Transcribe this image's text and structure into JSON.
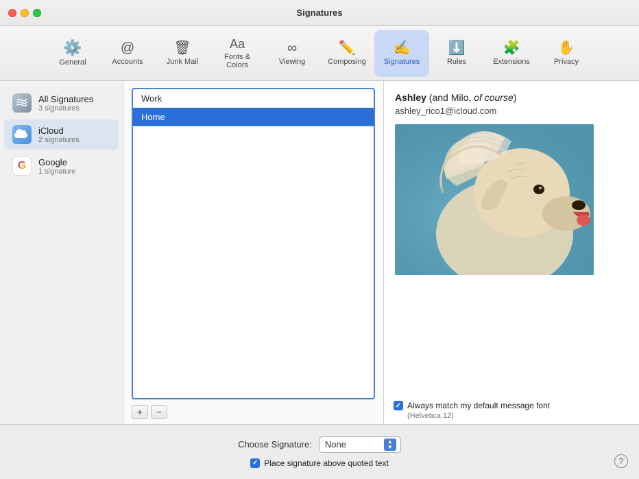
{
  "window": {
    "title": "Signatures"
  },
  "toolbar": {
    "items": [
      {
        "id": "general",
        "label": "General",
        "icon": "⚙️"
      },
      {
        "id": "accounts",
        "label": "Accounts",
        "icon": "＠"
      },
      {
        "id": "junk-mail",
        "label": "Junk Mail",
        "icon": "🗑"
      },
      {
        "id": "fonts-colors",
        "label": "Fonts & Colors",
        "icon": "Aa"
      },
      {
        "id": "viewing",
        "label": "Viewing",
        "icon": "∞"
      },
      {
        "id": "composing",
        "label": "Composing",
        "icon": "✏"
      },
      {
        "id": "signatures",
        "label": "Signatures",
        "icon": "✍"
      },
      {
        "id": "rules",
        "label": "Rules",
        "icon": "↓"
      },
      {
        "id": "extensions",
        "label": "Extensions",
        "icon": "🧩"
      },
      {
        "id": "privacy",
        "label": "Privacy",
        "icon": "✋"
      }
    ]
  },
  "sidebar": {
    "items": [
      {
        "id": "all-signatures",
        "name": "All Signatures",
        "count": "3 signatures",
        "iconType": "all"
      },
      {
        "id": "icloud",
        "name": "iCloud",
        "count": "2 signatures",
        "iconType": "icloud"
      },
      {
        "id": "google",
        "name": "Google",
        "count": "1 signature",
        "iconType": "google"
      }
    ]
  },
  "signatures_list": {
    "items": [
      {
        "id": "work",
        "label": "Work",
        "selected": false
      },
      {
        "id": "home",
        "label": "Home",
        "selected": true
      }
    ],
    "add_button": "+",
    "remove_button": "−"
  },
  "preview": {
    "name_bold": "Ashley",
    "name_rest": " (and Milo, ",
    "name_italic": "of course",
    "name_end": ")",
    "email": "ashley_rico1@icloud.com"
  },
  "font_option": {
    "label": "Always match my default message font",
    "sublabel": "(Helvetica 12)"
  },
  "bottom": {
    "choose_label": "Choose Signature:",
    "choose_value": "None",
    "place_label": "Place signature above quoted text",
    "help": "?"
  }
}
